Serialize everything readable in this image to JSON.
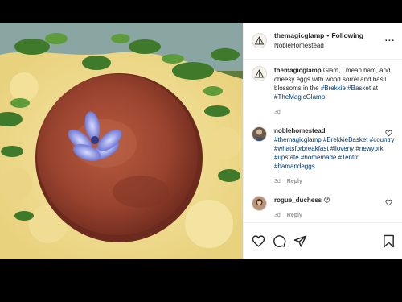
{
  "post": {
    "username": "themagicglamp",
    "follow_label": "Following",
    "location": "NobleHomestead",
    "more_label": "···"
  },
  "caption": {
    "username": "themagicglamp",
    "text_before": "Glam, I mean ham, and cheesy eggs with wood sorrel and basil blossoms in the ",
    "tags": [
      "#Brekkie",
      "#Basket"
    ],
    "text_at": "at ",
    "tag_at": "#TheMagicGlamp",
    "age": "3d"
  },
  "comments": [
    {
      "username": "noblehomestead",
      "tags": [
        "#themagicglamp",
        "#BrekkieBasket",
        "#country",
        "#whatsforbreakfast",
        "#iloveny",
        "#newyork",
        "#upstate",
        "#homemade",
        "#Tentrr",
        "#hamandeggs"
      ],
      "age": "3d",
      "reply_label": "Reply"
    },
    {
      "username": "rogue_duchess",
      "emoji": "😍",
      "age": "3d",
      "reply_label": "Reply"
    }
  ],
  "icons": {
    "like": "heart-icon",
    "comment": "comment-icon",
    "share": "send-icon",
    "save": "bookmark-icon",
    "more": "more-icon"
  },
  "colors": {
    "hashtag": "#00376b",
    "text": "#262626",
    "muted": "#8e8e8e"
  }
}
